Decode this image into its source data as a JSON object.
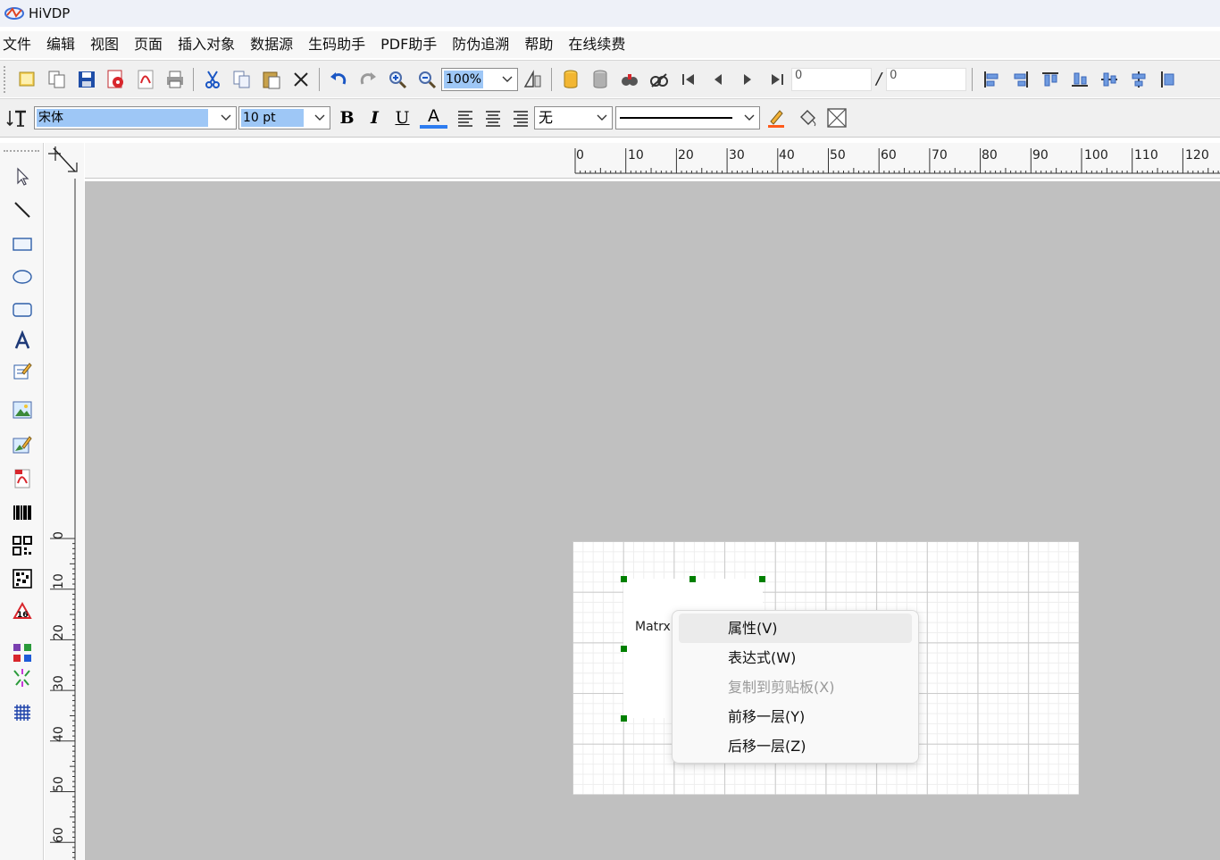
{
  "titlebar": {
    "title": "HiVDP",
    "icon": "hivdp-app-icon"
  },
  "menubar": {
    "items": [
      "文件",
      "编辑",
      "视图",
      "页面",
      "插入对象",
      "数据源",
      "生码助手",
      "PDF助手",
      "防伪追溯",
      "帮助",
      "在线续费"
    ]
  },
  "toolbar_main": {
    "zoom_value": "100%",
    "page_current": "0",
    "page_total": "0",
    "page_separator": "/"
  },
  "toolbar_format": {
    "font_family": "宋体",
    "font_size": "10 pt",
    "bold_label": "B",
    "italic_label": "I",
    "underline_label": "U",
    "color_label": "A",
    "border_value": "无",
    "accent_blue": "#0a64c8",
    "selection_highlight": "#9ec7f6"
  },
  "ruler": {
    "horizontal": [
      "0",
      "10",
      "20",
      "30",
      "40",
      "50",
      "60",
      "70",
      "80",
      "90",
      "100",
      "110",
      "120"
    ],
    "vertical": [
      "0",
      "10",
      "20",
      "30",
      "40",
      "50",
      "60"
    ]
  },
  "canvas": {
    "background": "#c0c0c0",
    "object_label": "Matrx",
    "handle_color": "#008000"
  },
  "context_menu": {
    "items": [
      {
        "label": "属性(V)",
        "state": "hover"
      },
      {
        "label": "表达式(W)",
        "state": "normal"
      },
      {
        "label": "复制到剪贴板(X)",
        "state": "disabled"
      },
      {
        "label": "前移一层(Y)",
        "state": "normal"
      },
      {
        "label": "后移一层(Z)",
        "state": "normal"
      }
    ]
  }
}
